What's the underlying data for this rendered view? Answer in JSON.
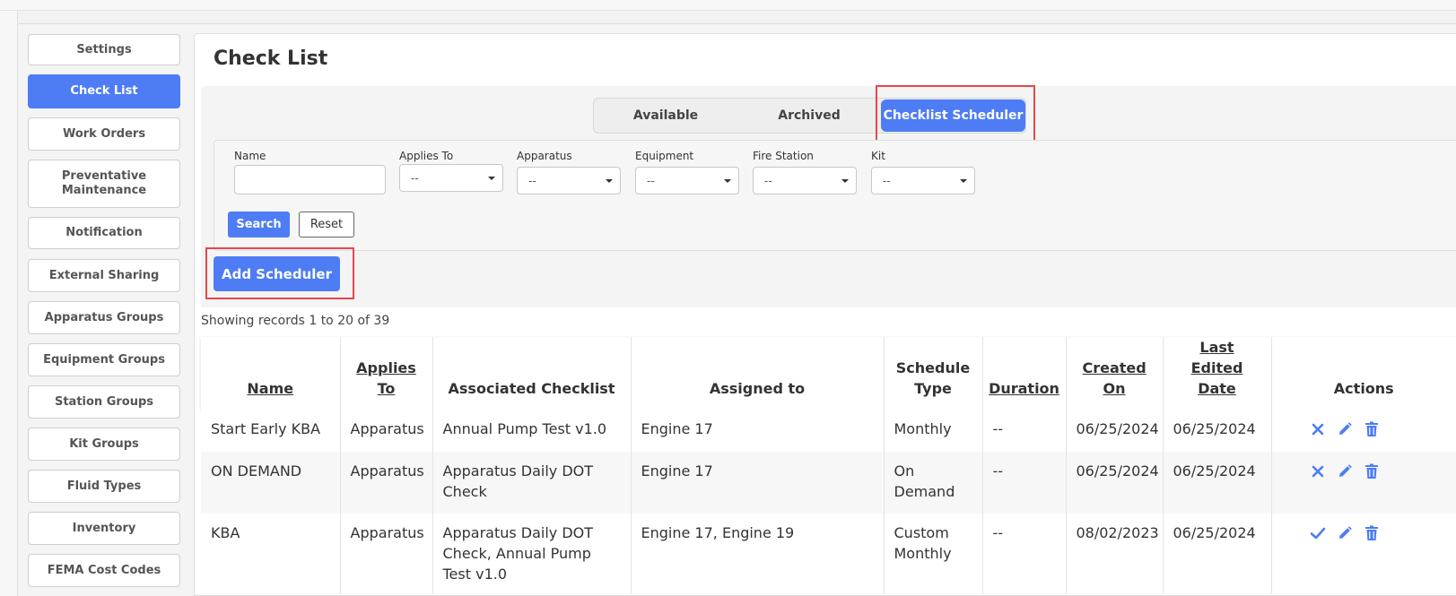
{
  "sidebar": {
    "items": [
      {
        "label": "Settings",
        "active": false
      },
      {
        "label": "Check List",
        "active": true
      },
      {
        "label": "Work Orders",
        "active": false
      },
      {
        "label": "Preventative Maintenance",
        "active": false
      },
      {
        "label": "Notification",
        "active": false
      },
      {
        "label": "External Sharing",
        "active": false
      },
      {
        "label": "Apparatus Groups",
        "active": false
      },
      {
        "label": "Equipment Groups",
        "active": false
      },
      {
        "label": "Station Groups",
        "active": false
      },
      {
        "label": "Kit Groups",
        "active": false
      },
      {
        "label": "Fluid Types",
        "active": false
      },
      {
        "label": "Inventory",
        "active": false
      },
      {
        "label": "FEMA Cost Codes",
        "active": false
      }
    ]
  },
  "page": {
    "title": "Check List"
  },
  "tabs": [
    {
      "label": "Available",
      "active": false
    },
    {
      "label": "Archived",
      "active": false
    },
    {
      "label": "Checklist Scheduler",
      "active": true
    }
  ],
  "filters": {
    "name": {
      "label": "Name",
      "value": ""
    },
    "applies_to": {
      "label": "Applies To",
      "value": "--"
    },
    "apparatus": {
      "label": "Apparatus",
      "value": "--"
    },
    "equipment": {
      "label": "Equipment",
      "value": "--"
    },
    "fire_station": {
      "label": "Fire Station",
      "value": "--"
    },
    "kit": {
      "label": "Kit",
      "value": "--"
    },
    "search_label": "Search",
    "reset_label": "Reset"
  },
  "add_scheduler_label": "Add Scheduler",
  "records_text": "Showing records 1 to 20 of 39",
  "table": {
    "headers": {
      "name": "Name",
      "applies_to": "Applies To",
      "associated_checklist": "Associated Checklist",
      "assigned_to": "Assigned to",
      "schedule_type": "Schedule Type",
      "duration": "Duration",
      "created_on": "Created On",
      "last_edited": "Last Edited Date",
      "actions": "Actions"
    },
    "rows": [
      {
        "name": "Start Early KBA",
        "applies_to": "Apparatus",
        "checklist": "Annual Pump Test v1.0",
        "assigned_to": "Engine 17",
        "schedule_type": "Monthly",
        "duration": "--",
        "created_on": "06/25/2024",
        "last_edited": "06/25/2024",
        "status_icon": "x-icon"
      },
      {
        "name": "ON DEMAND",
        "applies_to": "Apparatus",
        "checklist": "Apparatus Daily DOT Check",
        "assigned_to": "Engine 17",
        "schedule_type": "On Demand",
        "duration": "--",
        "created_on": "06/25/2024",
        "last_edited": "06/25/2024",
        "status_icon": "x-icon"
      },
      {
        "name": "KBA",
        "applies_to": "Apparatus",
        "checklist": "Apparatus Daily DOT Check, Annual Pump Test v1.0",
        "assigned_to": "Engine 17, Engine 19",
        "schedule_type": "Custom Monthly",
        "duration": "--",
        "created_on": "08/02/2023",
        "last_edited": "06/25/2024",
        "status_icon": "check-icon"
      }
    ]
  },
  "colors": {
    "accent": "#4d7cf4",
    "highlight": "#e5474c"
  }
}
